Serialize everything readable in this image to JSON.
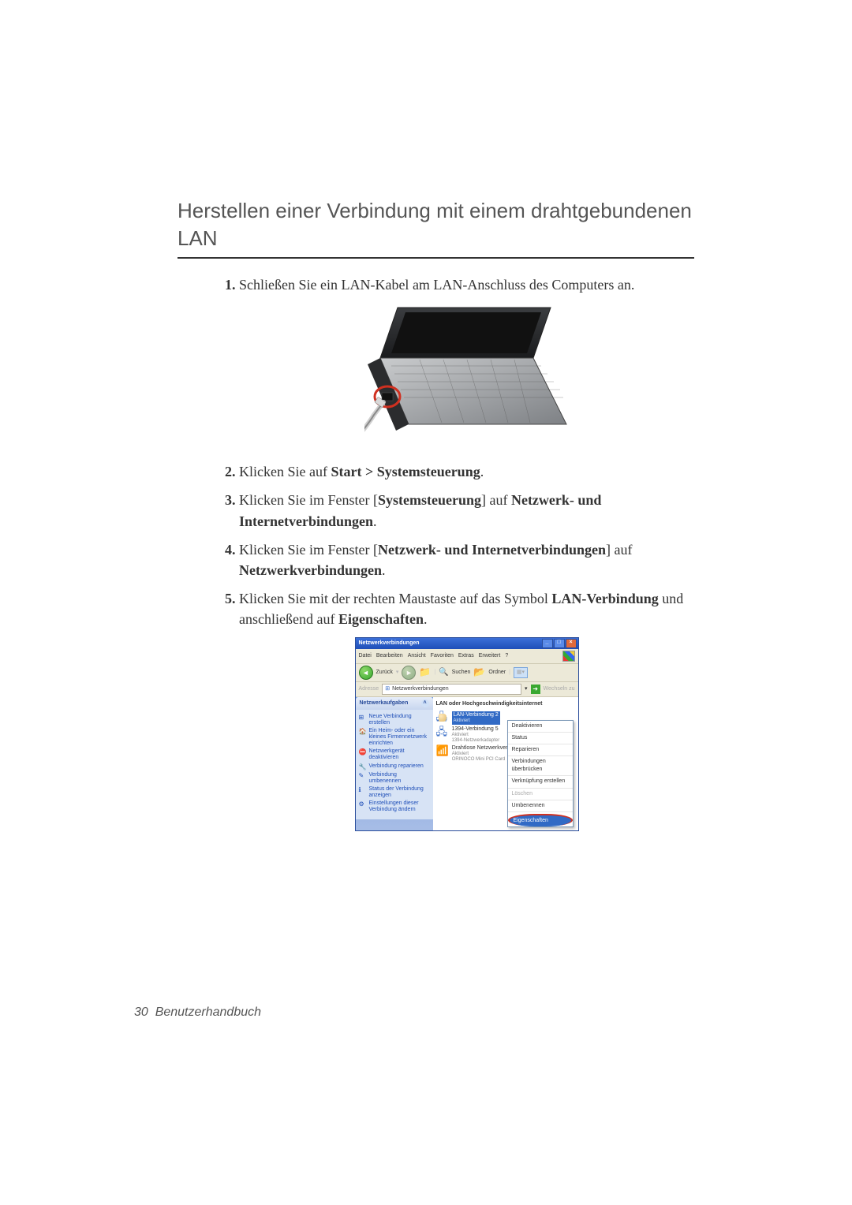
{
  "heading": "Herstellen einer Verbindung mit einem drahtgebundenen LAN",
  "steps": {
    "s1": "Schließen Sie ein LAN-Kabel am LAN-Anschluss des Computers an.",
    "s2_a": "Klicken Sie auf ",
    "s2_b": "Start > Systemsteuerung",
    "s2_c": ".",
    "s3_a": "Klicken Sie im Fenster [",
    "s3_b": "Systemsteuerung",
    "s3_c": "] auf ",
    "s3_d": "Netzwerk- und Internetverbindungen",
    "s3_e": ".",
    "s4_a": "Klicken Sie im Fenster [",
    "s4_b": "Netzwerk- und Internetverbindungen",
    "s4_c": "] auf ",
    "s4_d": "Netzwerkverbindungen",
    "s4_e": ".",
    "s5_a": "Klicken Sie mit der rechten Maustaste auf das Symbol ",
    "s5_b": "LAN-Verbindung",
    "s5_c": " und anschließend auf ",
    "s5_d": "Eigenschaften",
    "s5_e": "."
  },
  "win": {
    "title": "Netzwerkverbindungen",
    "menu": [
      "Datei",
      "Bearbeiten",
      "Ansicht",
      "Favoriten",
      "Extras",
      "Erweitert",
      "?"
    ],
    "toolbar": {
      "back": "Zurück",
      "search": "Suchen",
      "folders": "Ordner"
    },
    "address": {
      "label": "Adresse",
      "value": "Netzwerkverbindungen",
      "go": "Wechseln zu"
    },
    "sidebar": {
      "title": "Netzwerkaufgaben",
      "links": [
        "Neue Verbindung erstellen",
        "Ein Heim- oder ein kleines Firmennetzwerk einrichten",
        "Netzwerkgerät deaktivieren",
        "Verbindung reparieren",
        "Verbindung umbenennen",
        "Status der Verbindung anzeigen",
        "Einstellungen dieser Verbindung ändern"
      ]
    },
    "content": {
      "header": "LAN oder Hochgeschwindigkeitsinternet",
      "conn1": {
        "name": "LAN-Verbindung 2",
        "sub": "Aktiviert"
      },
      "conn2": {
        "name": "1394-Verbindung 5",
        "sub1": "Aktiviert",
        "sub2": "1394-Netzwerkadapter"
      },
      "conn3": {
        "name": "Drahtlose Netzwerkverbindung",
        "sub1": "Aktiviert",
        "sub2": "ORINOCO Mini PCI Card"
      }
    },
    "context": [
      "Deaktivieren",
      "Status",
      "Reparieren",
      "Verbindungen überbrücken",
      "Verknüpfung erstellen",
      "Löschen",
      "Umbenennen",
      "Eigenschaften"
    ]
  },
  "footer": {
    "page": "30",
    "title": "Benutzerhandbuch"
  }
}
